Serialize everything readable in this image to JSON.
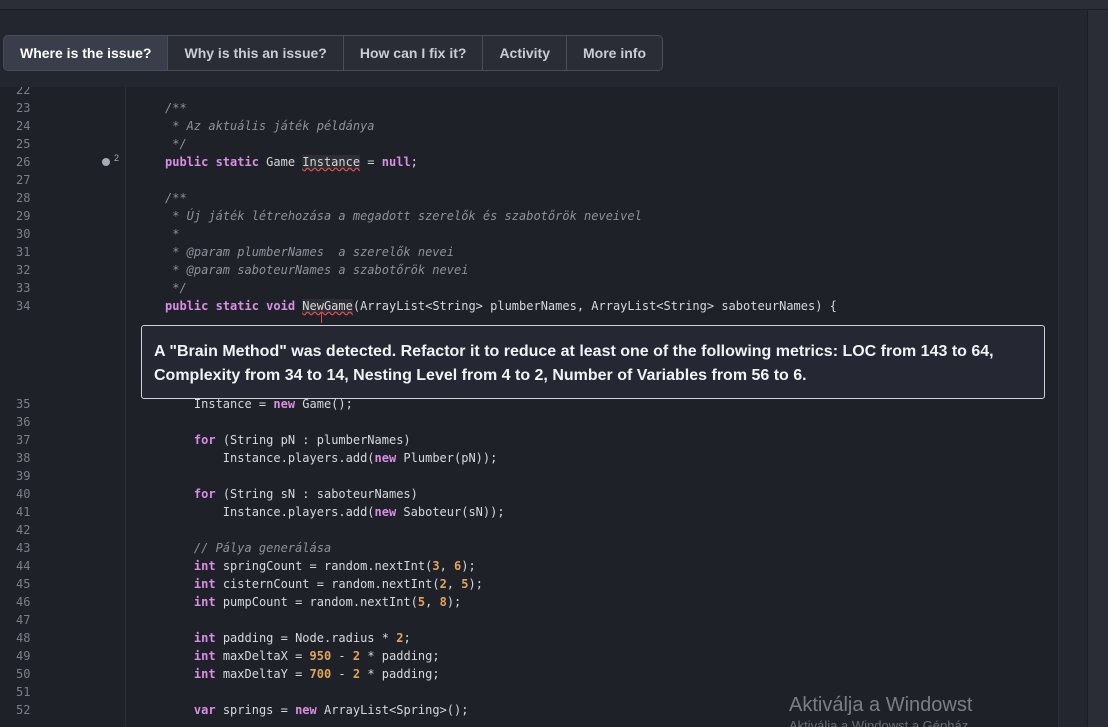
{
  "tabs": [
    {
      "label": "Where is the issue?",
      "active": true
    },
    {
      "label": "Why is this an issue?"
    },
    {
      "label": "How can I fix it?"
    },
    {
      "label": "Activity"
    },
    {
      "label": "More info"
    }
  ],
  "marker": {
    "count": "2"
  },
  "issue": {
    "message": "A \"Brain Method\" was detected. Refactor it to reduce at least one of the following metrics: LOC from 143 to 64, Complexity from 34 to 14, Nesting Level from 4 to 2, Number of Variables from 56 to 6."
  },
  "code_lines": [
    {
      "n": "22",
      "tokens": []
    },
    {
      "n": "23",
      "tokens": [
        [
          "cm",
          "/**"
        ]
      ]
    },
    {
      "n": "24",
      "tokens": [
        [
          "cm",
          " * Az aktuális játék példánya"
        ]
      ]
    },
    {
      "n": "25",
      "tokens": [
        [
          "cm",
          " */"
        ]
      ]
    },
    {
      "n": "26",
      "tokens": [
        [
          "kw",
          "public static"
        ],
        [
          "",
          " Game "
        ],
        [
          "issue",
          "Instance"
        ],
        [
          "",
          " = "
        ],
        [
          "kw",
          "null"
        ],
        [
          "",
          ";"
        ]
      ]
    },
    {
      "n": "27",
      "tokens": []
    },
    {
      "n": "28",
      "tokens": [
        [
          "cm",
          "/**"
        ]
      ]
    },
    {
      "n": "29",
      "tokens": [
        [
          "cm",
          " * Új játék létrehozása a megadott szerelők és szabotőrök neveivel"
        ]
      ]
    },
    {
      "n": "30",
      "tokens": [
        [
          "cm",
          " *"
        ]
      ]
    },
    {
      "n": "31",
      "tokens": [
        [
          "cm",
          " * @param plumberNames  a szerelők nevei"
        ]
      ]
    },
    {
      "n": "32",
      "tokens": [
        [
          "cm",
          " * @param saboteurNames a szabotőrök nevei"
        ]
      ]
    },
    {
      "n": "33",
      "tokens": [
        [
          "cm",
          " */"
        ]
      ]
    },
    {
      "n": "34",
      "tokens": [
        [
          "kw",
          "public static void"
        ],
        [
          "",
          " "
        ],
        [
          "issue",
          "NewGame"
        ],
        [
          "",
          "(ArrayList<String> plumberNames, ArrayList<String> saboteurNames) {"
        ]
      ]
    },
    {
      "n": "35",
      "tokens": [
        [
          "",
          "    Instance = "
        ],
        [
          "kw",
          "new"
        ],
        [
          "",
          " Game();"
        ]
      ]
    },
    {
      "n": "36",
      "tokens": []
    },
    {
      "n": "37",
      "tokens": [
        [
          "",
          "    "
        ],
        [
          "kw",
          "for"
        ],
        [
          "",
          " (String pN : plumberNames)"
        ]
      ]
    },
    {
      "n": "38",
      "tokens": [
        [
          "",
          "        Instance.players.add("
        ],
        [
          "kw",
          "new"
        ],
        [
          "",
          " Plumber(pN));"
        ]
      ]
    },
    {
      "n": "39",
      "tokens": []
    },
    {
      "n": "40",
      "tokens": [
        [
          "",
          "    "
        ],
        [
          "kw",
          "for"
        ],
        [
          "",
          " (String sN : saboteurNames)"
        ]
      ]
    },
    {
      "n": "41",
      "tokens": [
        [
          "",
          "        Instance.players.add("
        ],
        [
          "kw",
          "new"
        ],
        [
          "",
          " Saboteur(sN));"
        ]
      ]
    },
    {
      "n": "42",
      "tokens": []
    },
    {
      "n": "43",
      "tokens": [
        [
          "",
          "    "
        ],
        [
          "cm",
          "// Pálya generálása"
        ]
      ]
    },
    {
      "n": "44",
      "tokens": [
        [
          "",
          "    "
        ],
        [
          "kw",
          "int"
        ],
        [
          "",
          " springCount = random.nextInt("
        ],
        [
          "num",
          "3"
        ],
        [
          "",
          ", "
        ],
        [
          "num",
          "6"
        ],
        [
          "",
          ");"
        ]
      ]
    },
    {
      "n": "45",
      "tokens": [
        [
          "",
          "    "
        ],
        [
          "kw",
          "int"
        ],
        [
          "",
          " cisternCount = random.nextInt("
        ],
        [
          "num",
          "2"
        ],
        [
          "",
          ", "
        ],
        [
          "num",
          "5"
        ],
        [
          "",
          ");"
        ]
      ]
    },
    {
      "n": "46",
      "tokens": [
        [
          "",
          "    "
        ],
        [
          "kw",
          "int"
        ],
        [
          "",
          " pumpCount = random.nextInt("
        ],
        [
          "num",
          "5"
        ],
        [
          "",
          ", "
        ],
        [
          "num",
          "8"
        ],
        [
          "",
          ");"
        ]
      ]
    },
    {
      "n": "47",
      "tokens": []
    },
    {
      "n": "48",
      "tokens": [
        [
          "",
          "    "
        ],
        [
          "kw",
          "int"
        ],
        [
          "",
          " padding = Node.radius * "
        ],
        [
          "num",
          "2"
        ],
        [
          "",
          ";"
        ]
      ]
    },
    {
      "n": "49",
      "tokens": [
        [
          "",
          "    "
        ],
        [
          "kw",
          "int"
        ],
        [
          "",
          " maxDeltaX = "
        ],
        [
          "num",
          "950"
        ],
        [
          "",
          " - "
        ],
        [
          "num",
          "2"
        ],
        [
          "",
          " * padding;"
        ]
      ]
    },
    {
      "n": "50",
      "tokens": [
        [
          "",
          "    "
        ],
        [
          "kw",
          "int"
        ],
        [
          "",
          " maxDeltaY = "
        ],
        [
          "num",
          "700"
        ],
        [
          "",
          " - "
        ],
        [
          "num",
          "2"
        ],
        [
          "",
          " * padding;"
        ]
      ]
    },
    {
      "n": "51",
      "tokens": []
    },
    {
      "n": "52",
      "tokens": [
        [
          "",
          "    "
        ],
        [
          "kw",
          "var"
        ],
        [
          "",
          " springs = "
        ],
        [
          "kw",
          "new"
        ],
        [
          "",
          " ArrayList<Spring>();"
        ]
      ]
    }
  ],
  "watermark": {
    "line1": "Aktiválja a Windowst",
    "line2": "Aktiválja a Windowst a Gépház"
  }
}
